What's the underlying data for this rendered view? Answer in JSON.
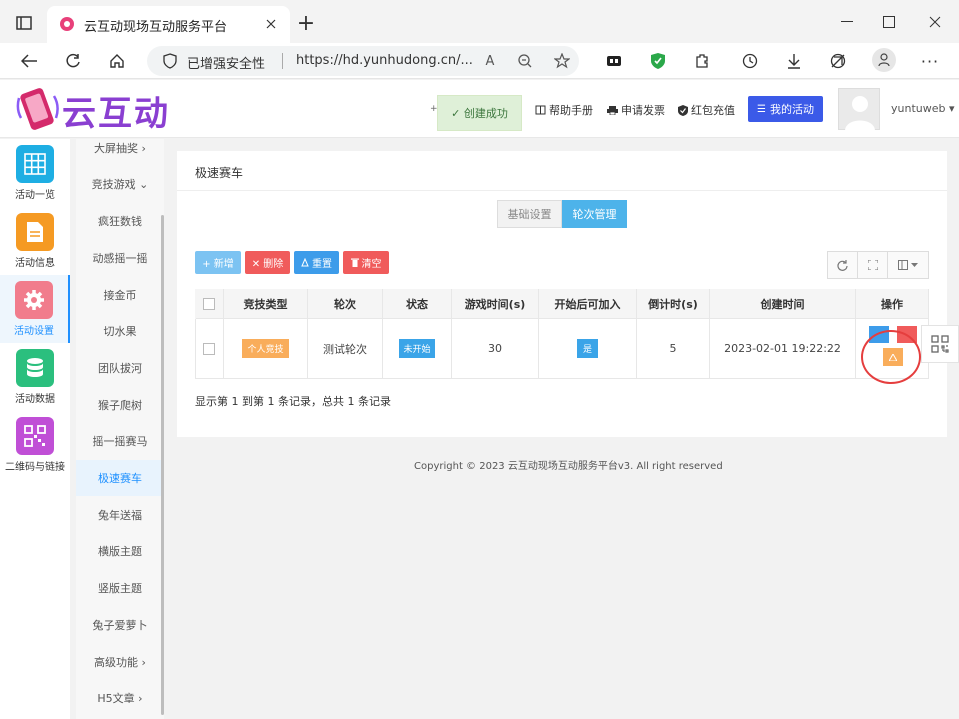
{
  "browser": {
    "tab_title": "云互动现场互动服务平台",
    "security_label": "已增强安全性",
    "url": "https://hd.yunhudong.cn/...",
    "new_tab_symbol": "+"
  },
  "header": {
    "logo_text": "云互动",
    "toast": "✓ 创建成功",
    "help_label": "帮助手册",
    "invoice_label": "申请发票",
    "recharge_label": "红包充值",
    "my_activity_label": "我的活动",
    "username": "yuntuweb ▾"
  },
  "sidebar": {
    "items": [
      {
        "label": "活动一览",
        "color": "#1eaee3"
      },
      {
        "label": "活动信息",
        "color": "#f59a23"
      },
      {
        "label": "活动设置",
        "color": "#f17c8c"
      },
      {
        "label": "活动数据",
        "color": "#2bbf7e"
      },
      {
        "label": "二维码与链接",
        "color": "#c04fd6"
      }
    ]
  },
  "submenu": {
    "items": [
      {
        "label": "大屏抽奖 ›"
      },
      {
        "label": "竞技游戏 ⌄"
      },
      {
        "label": "疯狂数钱"
      },
      {
        "label": "动感摇一摇"
      },
      {
        "label": "接金币"
      },
      {
        "label": "切水果"
      },
      {
        "label": "团队拔河"
      },
      {
        "label": "猴子爬树"
      },
      {
        "label": "摇一摇赛马"
      },
      {
        "label": "极速赛车"
      },
      {
        "label": "兔年送福"
      },
      {
        "label": "横版主题"
      },
      {
        "label": "竖版主题"
      },
      {
        "label": "兔子爱萝卜"
      },
      {
        "label": "高级功能 ›"
      },
      {
        "label": "H5文章 ›"
      }
    ]
  },
  "main": {
    "title": "极速赛车",
    "tabs": [
      "基础设置",
      "轮次管理"
    ],
    "actions": {
      "add": "+ 新增",
      "delete": "✕ 删除",
      "reset": "重置",
      "clear": "清空"
    },
    "table": {
      "headers": [
        "竞技类型",
        "轮次",
        "状态",
        "游戏时间(s)",
        "开始后可加入",
        "倒计时(s)",
        "创建时间",
        "操作"
      ],
      "row": {
        "type": "个人竞技",
        "round": "测试轮次",
        "status": "未开始",
        "game_time": "30",
        "joinable": "是",
        "countdown": "5",
        "created": "2023-02-01 19:22:22"
      }
    },
    "summary": "显示第 1 到第 1 条记录，总共 1 条记录"
  },
  "footer": {
    "copyright": "Copyright © 2023 云互动现场互动服务平台v3. All right reserved"
  }
}
